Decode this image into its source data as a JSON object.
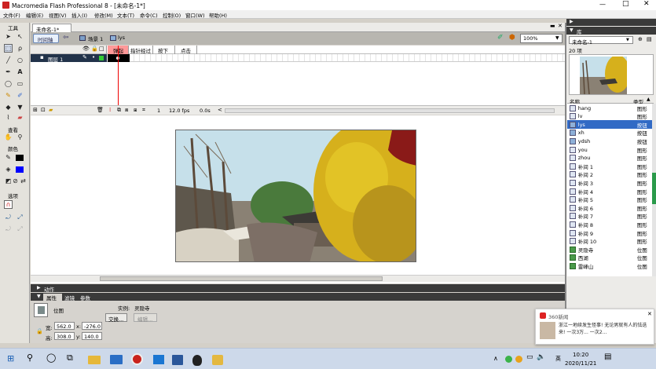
{
  "window": {
    "title": "Macromedia Flash Professional 8 - [未命名-1*]"
  },
  "menu": [
    "文件(F)",
    "编辑(E)",
    "视图(V)",
    "插入(I)",
    "修改(M)",
    "文本(T)",
    "命令(C)",
    "控制(O)",
    "窗口(W)",
    "帮助(H)"
  ],
  "tools": {
    "title": "工具",
    "view_label": "查看",
    "color_label": "颜色",
    "options_label": "选项"
  },
  "doc": {
    "tab": "未命名-1*",
    "timeline_btn": "时间轴",
    "scene": "场景 1",
    "symbol": "lys",
    "zoom": "100%"
  },
  "timeline": {
    "layer": "图层 1",
    "frames": [
      "弹起",
      "指针经过",
      "按下",
      "点击"
    ],
    "frame_num": "1",
    "fps": "12.0 fps",
    "time": "0.0s"
  },
  "panels": {
    "actions": "动作",
    "tabs": [
      "属性",
      "滤镜",
      "参数"
    ]
  },
  "props": {
    "kind": "位图",
    "instance_label": "实例:",
    "instance_name": "灵隐寺",
    "swap_btn": "交换...",
    "edit_btn": "编辑...",
    "w_label": "宽:",
    "w": "562.0",
    "h_label": "高:",
    "h": "308.0",
    "x_label": "x:",
    "x": "-276.0",
    "y_label": "y:",
    "y": "140.0"
  },
  "library": {
    "header": "库",
    "doc": "未命名-1",
    "count": "20 项",
    "col_name": "名称",
    "col_type": "类型",
    "items": [
      {
        "name": "hang",
        "type": "图形",
        "icon": "graphic"
      },
      {
        "name": "lv",
        "type": "图形",
        "icon": "graphic"
      },
      {
        "name": "lys",
        "type": "按钮",
        "icon": "button",
        "selected": true
      },
      {
        "name": "xh",
        "type": "按钮",
        "icon": "button"
      },
      {
        "name": "ydsh",
        "type": "按钮",
        "icon": "button"
      },
      {
        "name": "you",
        "type": "图形",
        "icon": "graphic"
      },
      {
        "name": "zhou",
        "type": "图形",
        "icon": "graphic"
      },
      {
        "name": "补间 1",
        "type": "图形",
        "icon": "graphic"
      },
      {
        "name": "补间 2",
        "type": "图形",
        "icon": "graphic"
      },
      {
        "name": "补间 3",
        "type": "图形",
        "icon": "graphic"
      },
      {
        "name": "补间 4",
        "type": "图形",
        "icon": "graphic"
      },
      {
        "name": "补间 5",
        "type": "图形",
        "icon": "graphic"
      },
      {
        "name": "补间 6",
        "type": "图形",
        "icon": "graphic"
      },
      {
        "name": "补间 7",
        "type": "图形",
        "icon": "graphic"
      },
      {
        "name": "补间 8",
        "type": "图形",
        "icon": "graphic"
      },
      {
        "name": "补间 9",
        "type": "图形",
        "icon": "graphic"
      },
      {
        "name": "补间 10",
        "type": "图形",
        "icon": "graphic"
      },
      {
        "name": "灵隐寺",
        "type": "位图",
        "icon": "bitmap"
      },
      {
        "name": "西湖",
        "type": "位图",
        "icon": "bitmap"
      },
      {
        "name": "雷峰山",
        "type": "位图",
        "icon": "bitmap"
      }
    ]
  },
  "notification": {
    "app": "360新闻",
    "text": "浙江一地续发生怪事! 无论男就有人的怯迭来! 一次3万... 一次2..."
  },
  "taskbar": {
    "time": "10:20",
    "date": "2020/11/21",
    "ime": "英"
  }
}
